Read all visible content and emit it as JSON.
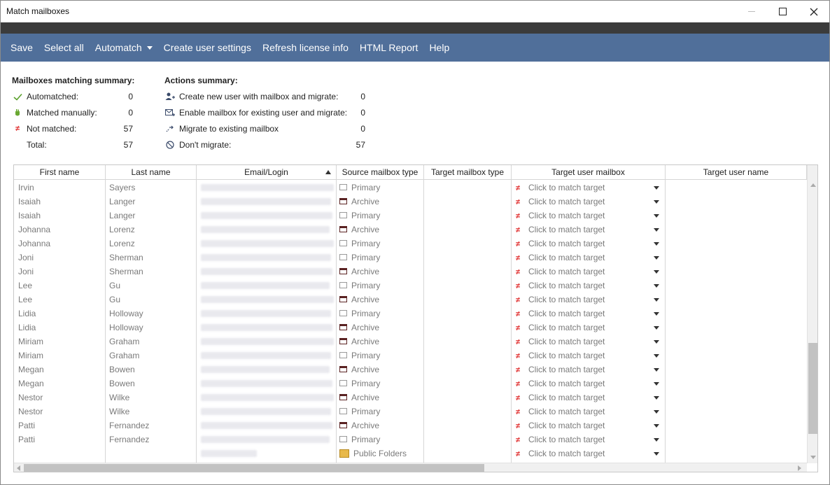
{
  "window": {
    "title": "Match mailboxes"
  },
  "toolbar": {
    "save": "Save",
    "select_all": "Select all",
    "automatch": "Automatch",
    "create_user_settings": "Create user settings",
    "refresh_license": "Refresh license info",
    "html_report": "HTML Report",
    "help": "Help"
  },
  "matching_summary": {
    "heading": "Mailboxes matching summary:",
    "items": [
      {
        "icon": "check-icon",
        "label": "Automatched:",
        "value": "0"
      },
      {
        "icon": "hand-icon",
        "label": "Matched manually:",
        "value": "0"
      },
      {
        "icon": "not-equal-icon",
        "label": "Not matched:",
        "value": "57"
      },
      {
        "icon": "",
        "label": "Total:",
        "value": "57"
      }
    ]
  },
  "actions_summary": {
    "heading": "Actions summary:",
    "items": [
      {
        "icon": "add-user-icon",
        "label": "Create new user with mailbox and migrate:",
        "value": "0"
      },
      {
        "icon": "enable-mailbox-icon",
        "label": "Enable mailbox for existing user and migrate:",
        "value": "0"
      },
      {
        "icon": "migrate-arrow-icon",
        "label": "Migrate to existing mailbox",
        "value": "0"
      },
      {
        "icon": "no-icon",
        "label": "Don't migrate:",
        "value": "57"
      }
    ]
  },
  "grid": {
    "columns": [
      "First name",
      "Last name",
      "Email/Login",
      "Source mailbox type",
      "Target mailbox type",
      "Target user mailbox",
      "Target user name"
    ],
    "sorted_column": "Email/Login",
    "placeholder": "Click to match target",
    "rows": [
      {
        "first": "Irvin",
        "last": "Sayers",
        "type": "Primary"
      },
      {
        "first": "Isaiah",
        "last": "Langer",
        "type": "Archive"
      },
      {
        "first": "Isaiah",
        "last": "Langer",
        "type": "Primary"
      },
      {
        "first": "Johanna",
        "last": "Lorenz",
        "type": "Archive"
      },
      {
        "first": "Johanna",
        "last": "Lorenz",
        "type": "Primary"
      },
      {
        "first": "Joni",
        "last": "Sherman",
        "type": "Primary"
      },
      {
        "first": "Joni",
        "last": "Sherman",
        "type": "Archive"
      },
      {
        "first": "Lee",
        "last": "Gu",
        "type": "Primary"
      },
      {
        "first": "Lee",
        "last": "Gu",
        "type": "Archive"
      },
      {
        "first": "Lidia",
        "last": "Holloway",
        "type": "Primary"
      },
      {
        "first": "Lidia",
        "last": "Holloway",
        "type": "Archive"
      },
      {
        "first": "Miriam",
        "last": "Graham",
        "type": "Archive"
      },
      {
        "first": "Miriam",
        "last": "Graham",
        "type": "Primary"
      },
      {
        "first": "Megan",
        "last": "Bowen",
        "type": "Archive"
      },
      {
        "first": "Megan",
        "last": "Bowen",
        "type": "Primary"
      },
      {
        "first": "Nestor",
        "last": "Wilke",
        "type": "Archive"
      },
      {
        "first": "Nestor",
        "last": "Wilke",
        "type": "Primary"
      },
      {
        "first": "Patti",
        "last": "Fernandez",
        "type": "Archive"
      },
      {
        "first": "Patti",
        "last": "Fernandez",
        "type": "Primary"
      },
      {
        "first": "",
        "last": "",
        "type": "Public Folders"
      }
    ]
  }
}
